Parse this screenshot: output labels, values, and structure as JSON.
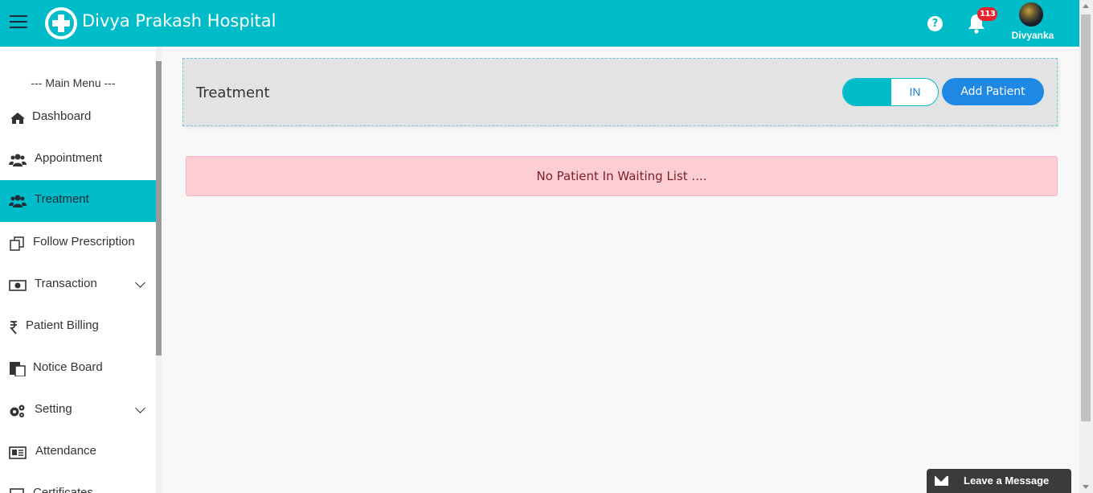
{
  "header": {
    "brand": "Divya Prakash Hospital",
    "help_glyph": "?",
    "notifications_count": "113",
    "user_name": "Divyanka",
    "accent_color": "#00bcc8"
  },
  "sidebar": {
    "menu_title": "--- Main Menu ---",
    "items": [
      {
        "label": "Dashboard",
        "icon": "home-icon"
      },
      {
        "label": "Appointment",
        "icon": "users-icon"
      },
      {
        "label": "Treatment",
        "icon": "users-icon",
        "active": true
      },
      {
        "label": "Follow Prescription",
        "icon": "copy-icon"
      },
      {
        "label": "Transaction",
        "icon": "money-icon",
        "expandable": true
      },
      {
        "label": "Patient Billing",
        "icon": "rupee-icon"
      },
      {
        "label": "Notice Board",
        "icon": "clipboard-icon"
      },
      {
        "label": "Setting",
        "icon": "cogs-icon",
        "expandable": true
      },
      {
        "label": "Attendance",
        "icon": "id-card-icon"
      },
      {
        "label": "Certificates",
        "icon": "certificate-icon"
      }
    ]
  },
  "main": {
    "title": "Treatment",
    "toggle_label": "IN",
    "add_patient_label": "Add Patient",
    "alert_text": "No Patient In Waiting List ...."
  },
  "chat_widget": {
    "label": "Leave a Message"
  }
}
